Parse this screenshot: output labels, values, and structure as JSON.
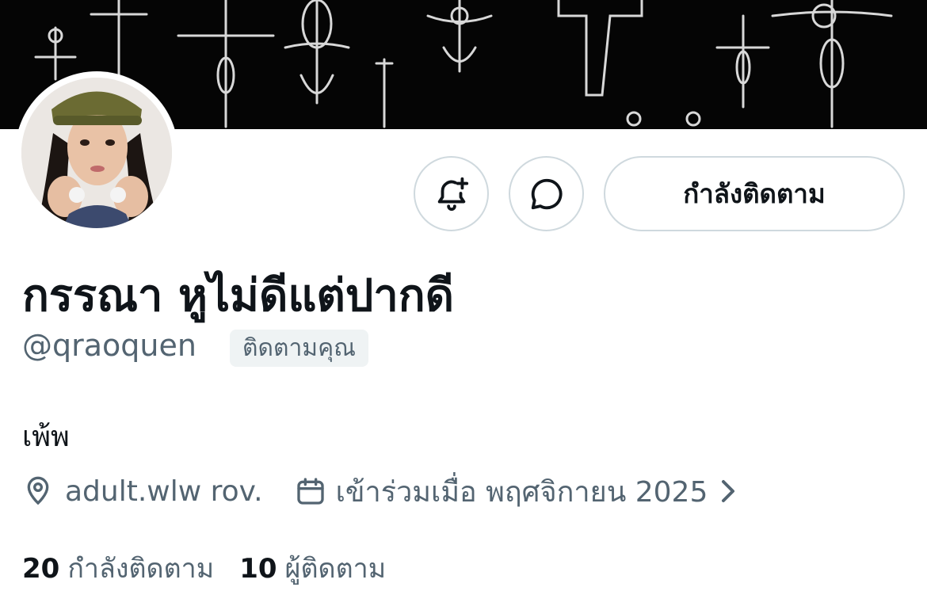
{
  "profile": {
    "display_name": "กรรณา หูไม่ดีแต่ปากดี",
    "handle": "@qraoquen",
    "follows_you_badge": "ติดตามคุณ",
    "bio": "เพ้พ",
    "location": "adult.wlw rov.",
    "joined": "เข้าร่วมเมื่อ พฤศจิกายน 2025"
  },
  "actions": {
    "follow_label": "กำลังติดตาม",
    "notify_icon": "bell-plus-icon",
    "message_icon": "message-bubble-icon"
  },
  "stats": {
    "following_count": "20",
    "following_label": "กำลังติดตาม",
    "followers_count": "10",
    "followers_label": "ผู้ติดตาม"
  },
  "colors": {
    "text_primary": "#0f1419",
    "text_secondary": "#536471",
    "border": "#cfd9de",
    "badge_bg": "#eff3f4",
    "banner_bg": "#050505"
  }
}
